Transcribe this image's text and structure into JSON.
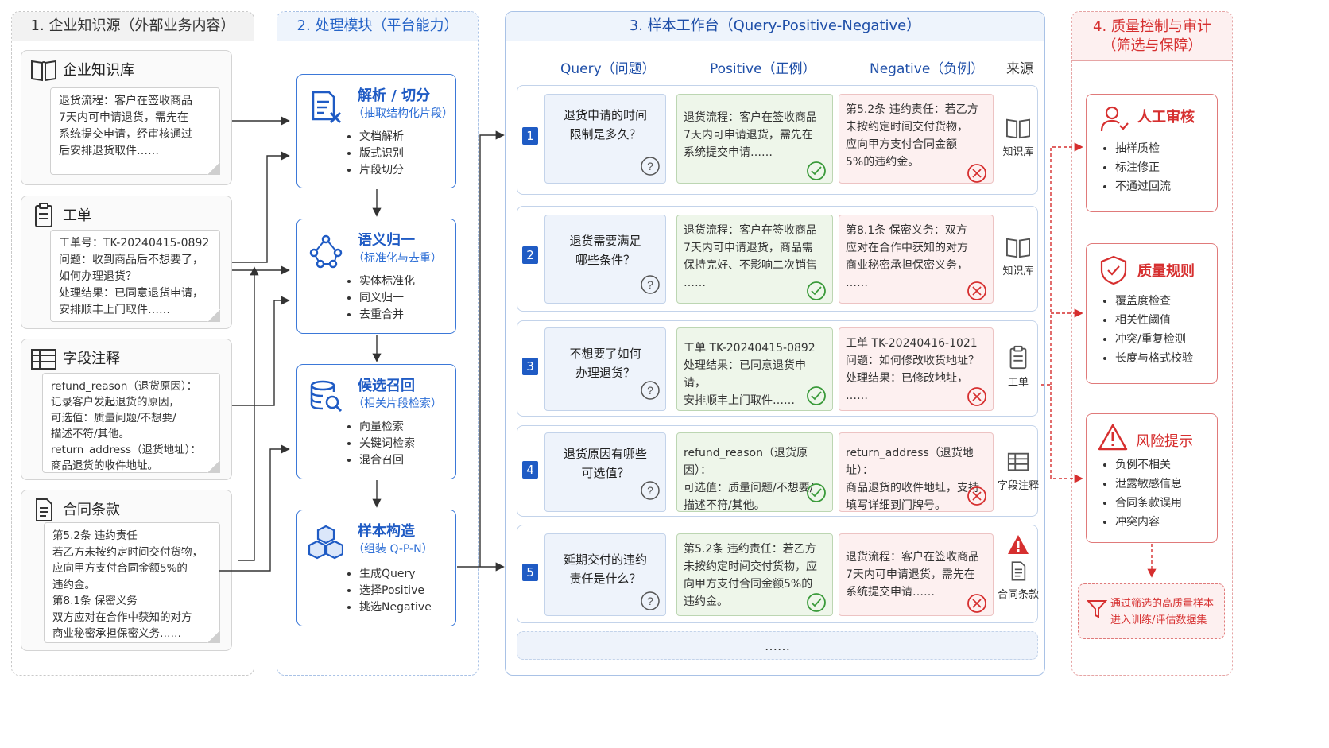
{
  "columns": {
    "c1": "1. 企业知识源（外部业务内容）",
    "c2": "2. 处理模块（平台能力）",
    "c3": "3. 样本工作台（Query-Positive-Negative）",
    "c4": "4. 质量控制与审计\n（筛选与保障）"
  },
  "sources": [
    {
      "title": "企业知识库",
      "icon": "book-icon",
      "text": "退货流程：客户在签收商品\n7天内可申请退货，需先在\n系统提交申请，经审核通过\n后安排退货取件……"
    },
    {
      "title": "工单",
      "icon": "clipboard-icon",
      "text": "工单号：TK-20240415-0892\n问题：收到商品后不想要了，\n如何办理退货？\n处理结果：已同意退货申请，\n安排顺丰上门取件……"
    },
    {
      "title": "字段注释",
      "icon": "table-icon",
      "text": "refund_reason（退货原因）：\n记录客户发起退货的原因，\n可选值：质量问题/不想要/\n描述不符/其他。\nreturn_address（退货地址）：\n商品退货的收件地址。"
    },
    {
      "title": "合同条款",
      "icon": "document-icon",
      "text": "第5.2条 违约责任\n若乙方未按约定时间交付货物，\n应向甲方支付合同金额5%的\n违约金。\n第8.1条 保密义务\n双方应对在合作中获知的对方\n商业秘密承担保密义务……"
    }
  ],
  "modules": [
    {
      "title": "解析 / 切分",
      "sub": "（抽取结构化片段）",
      "icon": "parse-icon",
      "items": [
        "文档解析",
        "版式识别",
        "片段切分"
      ]
    },
    {
      "title": "语义归一",
      "sub": "（标准化与去重）",
      "icon": "nodes-icon",
      "items": [
        "实体标准化",
        "同义归一",
        "去重合并"
      ]
    },
    {
      "title": "候选召回",
      "sub": "（相关片段检索）",
      "icon": "database-search-icon",
      "items": [
        "向量检索",
        "关键词检索",
        "混合召回"
      ]
    },
    {
      "title": "样本构造",
      "sub": "（组装 Q-P-N）",
      "icon": "cubes-icon",
      "items": [
        "生成Query",
        "选择Positive",
        "挑选Negative"
      ]
    }
  ],
  "workbench": {
    "headers": {
      "query": "Query（问题）",
      "positive": "Positive（正例）",
      "negative": "Negative（负例）",
      "source": "来源"
    },
    "rows": [
      {
        "num": "1",
        "query": "退货申请的时间\n限制是多久？",
        "positive": "退货流程：客户在签收商品\n7天内可申请退货，需先在\n系统提交申请……",
        "negative": "第5.2条 违约责任：若乙方\n未按约定时间交付货物，\n应向甲方支付合同金额\n5%的违约金。",
        "source": "知识库",
        "source_icon": "book-icon"
      },
      {
        "num": "2",
        "query": "退货需要满足\n哪些条件？",
        "positive": "退货流程：客户在签收商品\n7天内可申请退货，商品需\n保持完好、不影响二次销售\n……",
        "negative": "第8.1条 保密义务：双方\n应对在合作中获知的对方\n商业秘密承担保密义务，\n……",
        "source": "知识库",
        "source_icon": "book-icon"
      },
      {
        "num": "3",
        "query": "不想要了如何\n办理退货？",
        "positive": "工单 TK-20240415-0892\n处理结果：已同意退货申请，\n安排顺丰上门取件……",
        "negative": "工单 TK-20240416-1021\n问题：如何修改收货地址？\n处理结果：已修改地址，\n……",
        "source": "工单",
        "source_icon": "clipboard-icon"
      },
      {
        "num": "4",
        "query": "退货原因有哪些\n可选值？",
        "positive": "refund_reason（退货原因）：\n可选值：质量问题/不想要/\n描述不符/其他。",
        "negative": "return_address（退货地址）：\n商品退货的收件地址，支持\n填写详细到门牌号。",
        "source": "字段注释",
        "source_icon": "table-icon"
      },
      {
        "num": "5",
        "query": "延期交付的违约\n责任是什么？",
        "positive": "第5.2条 违约责任：若乙方\n未按约定时间交付货物，应\n向甲方支付合同金额5%的\n违约金。",
        "negative": "退货流程：客户在签收商品\n7天内可申请退货，需先在\n系统提交申请……",
        "source": "合同条款",
        "source_icon": "document-icon"
      }
    ],
    "more": "……"
  },
  "quality": [
    {
      "title": "人工审核",
      "icon": "reviewer-icon",
      "items": [
        "抽样质检",
        "标注修正",
        "不通过回流"
      ]
    },
    {
      "title": "质量规则",
      "icon": "shield-check-icon",
      "items": [
        "覆盖度检查",
        "相关性阈值",
        "冲突/重复检测",
        "长度与格式校验"
      ]
    },
    {
      "title": "风险提示",
      "icon": "warning-icon",
      "items": [
        "负例不相关",
        "泄露敏感信息",
        "合同条款误用",
        "冲突内容"
      ]
    }
  ],
  "final": "通过筛选的高质量样本\n进入训练/评估数据集",
  "colors": {
    "blue": "#1f5bc4",
    "red": "#d62f2f",
    "green": "#3a9a3a",
    "gray": "#c9c9c9"
  }
}
